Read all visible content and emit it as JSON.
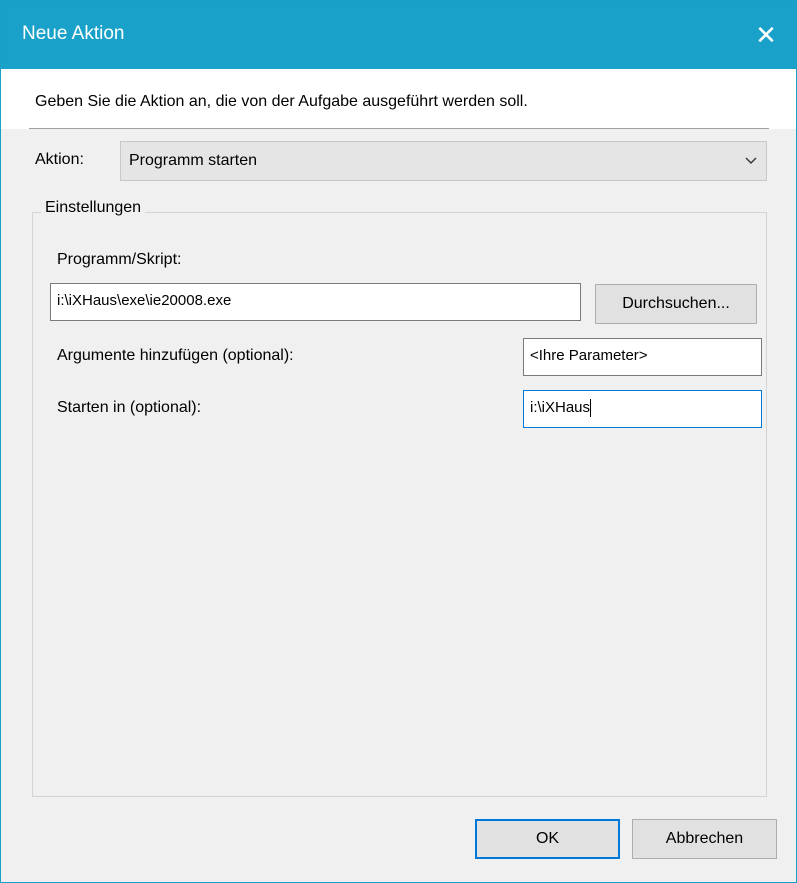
{
  "window": {
    "title": "Neue Aktion",
    "close_glyph": "✕"
  },
  "header": {
    "description": "Geben Sie die Aktion an, die von der Aufgabe ausgeführt werden soll."
  },
  "action": {
    "label": "Aktion:",
    "selected": "Programm starten",
    "icon": "chevron-down-icon"
  },
  "settings": {
    "group_title": "Einstellungen",
    "program_label": "Programm/Skript:",
    "program_value": "i:\\iXHaus\\exe\\ie20008.exe",
    "browse_label": "Durchsuchen...",
    "arguments_label": "Argumente hinzufügen (optional):",
    "arguments_value": "<Ihre Parameter>",
    "startin_label": "Starten in (optional):",
    "startin_value": "i:\\iXHaus"
  },
  "footer": {
    "ok_label": "OK",
    "cancel_label": "Abbrechen"
  },
  "colors": {
    "titlebar": "#19a1c9",
    "focus": "#0078d7"
  }
}
